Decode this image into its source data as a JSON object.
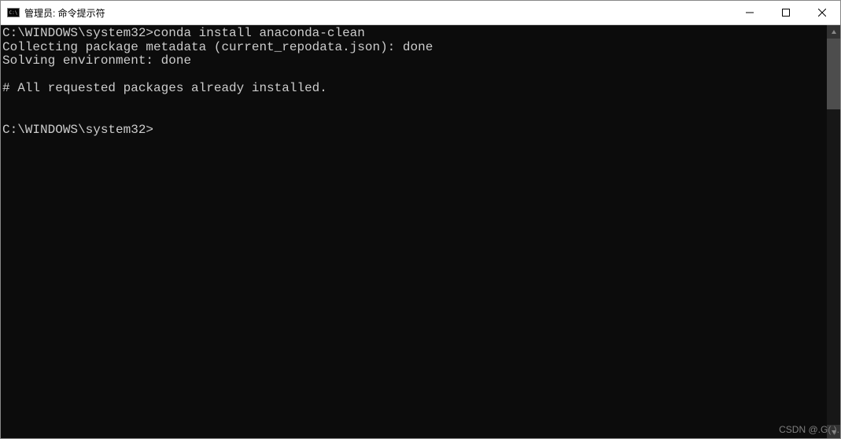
{
  "titlebar": {
    "title": "管理员: 命令提示符"
  },
  "terminal": {
    "lines": [
      "C:\\WINDOWS\\system32>conda install anaconda-clean",
      "Collecting package metadata (current_repodata.json): done",
      "Solving environment: done",
      "",
      "# All requested packages already installed.",
      "",
      "",
      "C:\\WINDOWS\\system32>"
    ]
  },
  "watermark": "CSDN @.G( )."
}
